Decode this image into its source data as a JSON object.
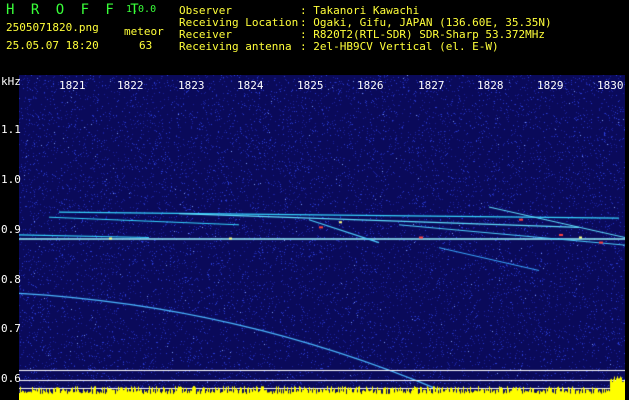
{
  "header": {
    "app_title": "H R O F F T",
    "app_version": "1.0.0",
    "file_name": "2505071820.png",
    "timestamp": "25.05.07 18:20",
    "meteor_label": "meteor",
    "meteor_count": "63",
    "info": [
      {
        "label": "Observer",
        "value": ": Takanori Kawachi"
      },
      {
        "label": "Receiving Location",
        "value": ": Ogaki, Gifu, JAPAN (136.60E, 35.35N)"
      },
      {
        "label": "Receiver",
        "value": ": R820T2(RTL-SDR) SDR-Sharp 53.372MHz"
      },
      {
        "label": "Receiving antenna",
        "value": ": 2el-HB9CV Vertical (el. E-W)"
      }
    ]
  },
  "spectrogram": {
    "axis_unit": "kHz",
    "time_ticks": [
      "1821",
      "1822",
      "1823",
      "1824",
      "1825",
      "1826",
      "1827",
      "1828",
      "1829",
      "1830"
    ],
    "freq_ticks": [
      "1.1",
      "1.0",
      "0.9",
      "0.8",
      "0.7",
      "0.6"
    ],
    "freq_ticks_values": [
      1.1,
      1.0,
      0.9,
      0.8,
      0.7,
      0.6
    ],
    "freq_range_khz": [
      0.56,
      1.2
    ],
    "time_range_min": [
      1820.6,
      1830.4
    ],
    "colors": {
      "background": "#0a0a5a",
      "noise": "#2b3fd8",
      "trace": "#36d6ff",
      "hot": "#ff4040",
      "activity": "#ffff00",
      "grid": "#ffffff"
    }
  }
}
